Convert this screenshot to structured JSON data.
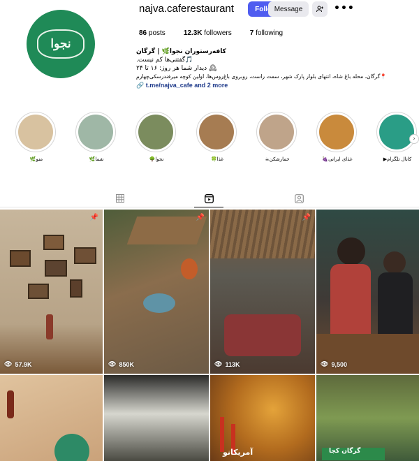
{
  "profile": {
    "username": "najva.caferestaurant",
    "follow_label": "Follow",
    "message_label": "Message",
    "avatar_text": "نجوا",
    "stats": {
      "posts": "86",
      "posts_label": "posts",
      "followers": "12.3K",
      "followers_label": "followers",
      "following": "7",
      "following_label": "following"
    },
    "bio": {
      "name": "کافه‌رستوران نجوا🌿 | گرگان",
      "line1": "🎵گفتنی‌ها کم نیست.",
      "line2": "🕰 دیدار شما هر روز: ۱۶ تا ۲۴",
      "line3": "📍گرگان، محله باغ شاه، انتهای بلوار پارک شهر، سمت راست، روبروی باغ‌روس‌ها، اولین کوچه میرفندرسکی‌چهارم",
      "link": "t.me/najva_cafe and 2 more"
    }
  },
  "highlights": [
    {
      "label": "منو🌿",
      "color": "#d8c2a0"
    },
    {
      "label": "شما🌿",
      "color": "#9fb7a6"
    },
    {
      "label": "نجوا🌳",
      "color": "#7b8c5e"
    },
    {
      "label": "غذا🍀",
      "color": "#a67c52"
    },
    {
      "label": "خمارشکن☕",
      "color": "#bfa48a"
    },
    {
      "label": "غذای ایرانی🍇",
      "color": "#c98a3c"
    },
    {
      "label": "کانال تلگرام▶",
      "color": "#2a9d86"
    }
  ],
  "tabs": {
    "posts": "grid-icon",
    "reels": "reels-icon",
    "tagged": "tagged-icon",
    "active": "reels"
  },
  "grid": [
    {
      "views": "57.9K",
      "pinned": true,
      "bg": "#b9a78f"
    },
    {
      "views": "850K",
      "pinned": true,
      "bg": "#6d7850"
    },
    {
      "views": "113K",
      "pinned": true,
      "bg": "#6f5a47"
    },
    {
      "views": "9,500",
      "pinned": false,
      "bg": "#3d5a4e"
    },
    {
      "views": "",
      "pinned": false,
      "bg": "#d9b894"
    },
    {
      "views": "",
      "pinned": false,
      "bg": "#3a3a38",
      "overlay": ""
    },
    {
      "views": "",
      "pinned": false,
      "bg": "#b5802e",
      "overlay": "آمریکانو"
    },
    {
      "views": "",
      "pinned": false,
      "bg": "#6f8a4a",
      "overlay": "گرگان کجا"
    }
  ],
  "colors": {
    "follow_bg": "#4f5cf0",
    "button_bg": "#e9e9ee",
    "avatar_bg": "#1f8a57",
    "link": "#1e3a8a"
  }
}
